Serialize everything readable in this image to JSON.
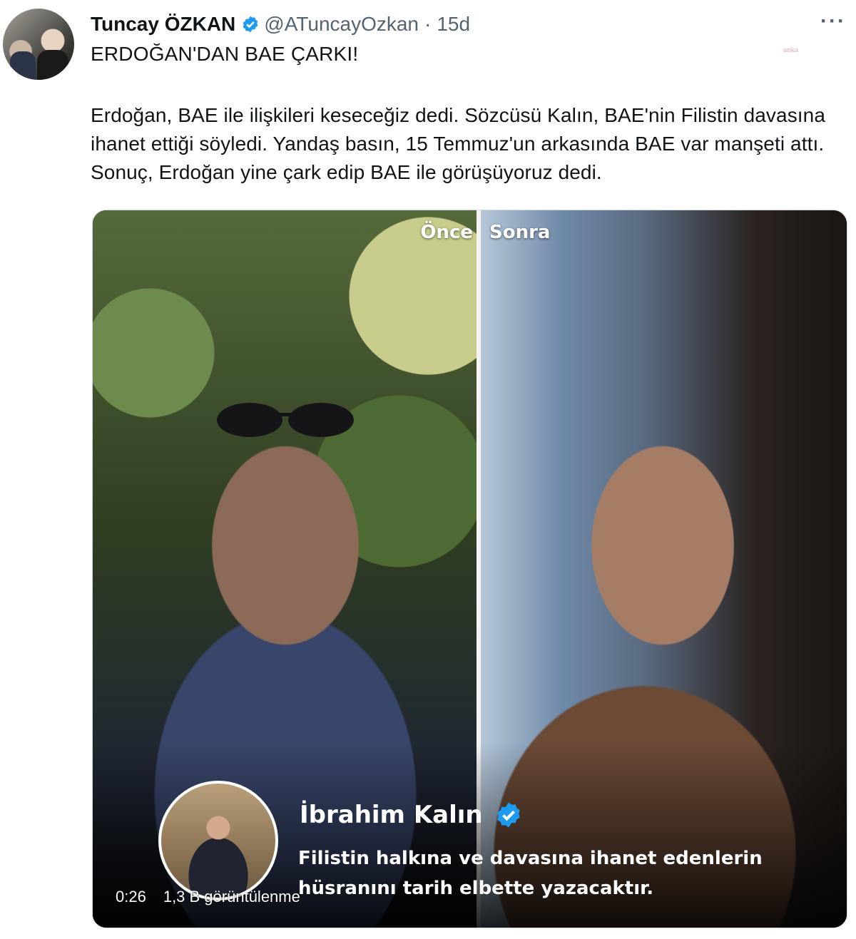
{
  "tweet": {
    "author_name": "Tuncay ÖZKAN",
    "handle": "@ATuncayOzkan",
    "separator": "·",
    "age": "15d",
    "more_label": "···",
    "headline": "ERDOĞAN'DAN BAE ÇARKI!",
    "body": "Erdoğan, BAE ile ilişkileri keseceğiz dedi. Sözcüsü Kalın, BAE'nin Filistin davasına ihanet ettiği söyledi. Yandaş basın, 15 Temmuz'un arkasında BAE var manşeti attı. Sonuç, Erdoğan yine çark edip BAE ile görüşüyoruz dedi.",
    "watermark": "anka"
  },
  "media": {
    "label_before": "Önce",
    "label_after": "Sonra",
    "quote_author": "İbrahim Kalın",
    "quote_text": "Filistin halkına ve davasına ihanet edenlerin hüsranını tarih elbette yazacaktır.",
    "duration": "0:26",
    "views": "1,3 B görüntülenme"
  },
  "colors": {
    "verified": "#1d9bf0",
    "muted_text": "#536471"
  }
}
